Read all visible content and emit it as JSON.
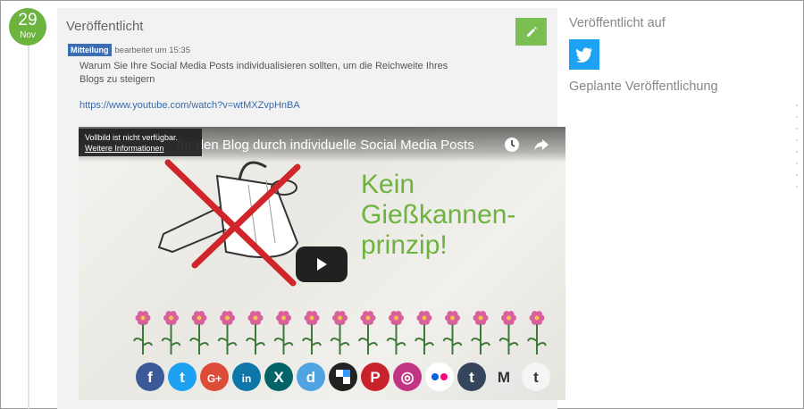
{
  "date": {
    "day": "29",
    "month": "Nov"
  },
  "post": {
    "status_title": "Veröffentlicht",
    "type_badge": "Mitteilung",
    "edited_label": "bearbeitet um 15:35",
    "text": "Warum Sie Ihre Social Media Posts individualisieren sollten, um die Reichweite Ihres Blogs zu steigern",
    "link": "https://www.youtube.com/watch?v=wtMXZvpHnBA"
  },
  "video": {
    "title": "für den Blog durch individuelle Social Media Posts",
    "tooltip_text": "Vollbild ist nicht verfügbar.",
    "tooltip_link": "Weitere Informationen",
    "headline_line1": "Kein",
    "headline_line2": "Gießkannen-",
    "headline_line3": "prinzip!",
    "accent_green": "#6cb33f",
    "cross_red": "#d0262b",
    "social_icons": [
      {
        "name": "facebook-icon",
        "glyph": "f",
        "color": "#3b5998"
      },
      {
        "name": "twitter-icon",
        "glyph": "t",
        "color": "#1da1f2"
      },
      {
        "name": "google-plus-icon",
        "glyph": "G+",
        "color": "#dd4b39"
      },
      {
        "name": "linkedin-icon",
        "glyph": "in",
        "color": "#0e76a8"
      },
      {
        "name": "xing-icon",
        "glyph": "X",
        "color": "#026466"
      },
      {
        "name": "delicious-icon",
        "glyph": "d",
        "color": "#4fa3e0"
      },
      {
        "name": "delicious-squares-icon",
        "glyph": "",
        "color": "#222222"
      },
      {
        "name": "pinterest-icon",
        "glyph": "P",
        "color": "#c8232c"
      },
      {
        "name": "instagram-icon",
        "glyph": "◎",
        "color": "#c13584"
      },
      {
        "name": "flickr-icon",
        "glyph": "●●",
        "color": "#ffffff"
      },
      {
        "name": "tumblr-icon",
        "glyph": "t",
        "color": "#35465c"
      },
      {
        "name": "medium-icon",
        "glyph": "M",
        "color": "#e8e8e8"
      },
      {
        "name": "tagesspiegel-icon",
        "glyph": "t",
        "color": "#f5f5f5"
      }
    ]
  },
  "sidebar": {
    "published_on": "Veröffentlicht auf",
    "scheduled": "Geplante Veröffentlichung",
    "twitter_color": "#1da1f2"
  }
}
